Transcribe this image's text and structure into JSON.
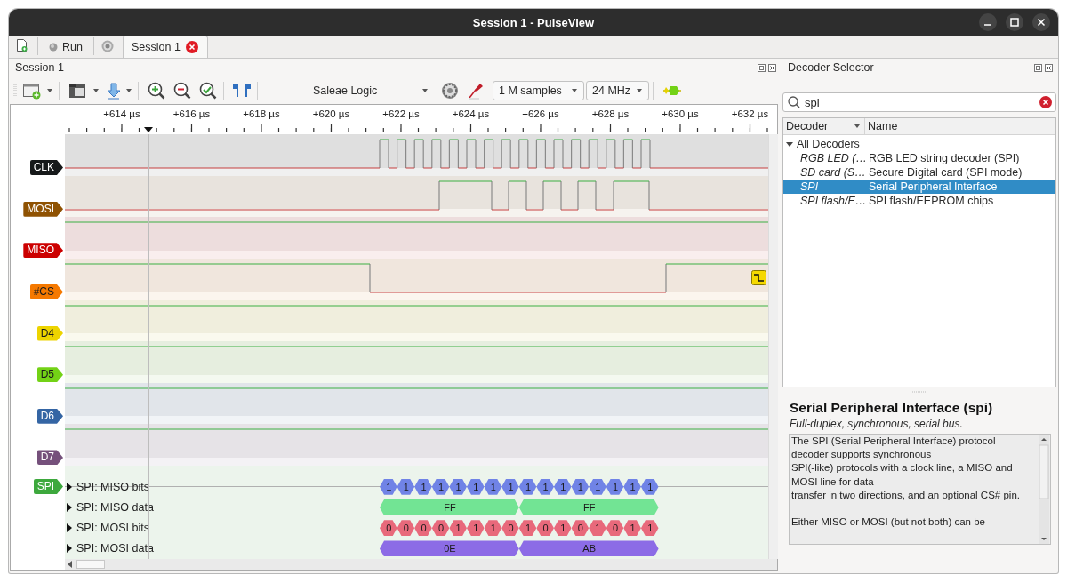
{
  "window": {
    "title": "Session 1 - PulseView"
  },
  "tab_bar": {
    "run_button": {
      "label": "Run"
    },
    "tabs": [
      {
        "label": "Session 1",
        "selected": true
      }
    ]
  },
  "session_panel": {
    "title": "Session 1",
    "toolbar": {
      "device": "Saleae Logic",
      "sample_count": "1 M samples",
      "sample_rate": "24 MHz"
    },
    "ruler": {
      "ticks": [
        "+614 µs",
        "+616 µs",
        "+618 µs",
        "+620 µs",
        "+622 µs",
        "+624 µs",
        "+626 µs",
        "+628 µs",
        "+630 µs",
        "+632 µs"
      ]
    },
    "channels": [
      {
        "name": "CLK",
        "color": "#16191a"
      },
      {
        "name": "MOSI",
        "color": "#8f5202"
      },
      {
        "name": "MISO",
        "color": "#cc0000"
      },
      {
        "name": "#CS",
        "color": "#f57900",
        "falling_edge_trigger": true
      },
      {
        "name": "D4",
        "color": "#edd400"
      },
      {
        "name": "D5",
        "color": "#73d216"
      },
      {
        "name": "D6",
        "color": "#3465a4"
      },
      {
        "name": "D7",
        "color": "#75507b"
      }
    ],
    "decoder": {
      "name": "SPI",
      "color": "#3da83d",
      "rows": [
        {
          "label": "SPI: MISO bits",
          "kind": "bits",
          "color": "#7083e6",
          "expanded": false,
          "annotations": [
            "1",
            "1",
            "1",
            "1",
            "1",
            "1",
            "1",
            "1",
            "1",
            "1",
            "1",
            "1",
            "1",
            "1",
            "1",
            "1"
          ]
        },
        {
          "label": "SPI: MISO data",
          "kind": "bytes",
          "color": "#72e494",
          "expanded": false,
          "annotations": [
            "FF",
            "FF"
          ]
        },
        {
          "label": "SPI: MOSI bits",
          "kind": "bits",
          "color": "#e8697b",
          "expanded": false,
          "annotations": [
            "0",
            "0",
            "0",
            "0",
            "1",
            "1",
            "1",
            "0",
            "1",
            "0",
            "1",
            "0",
            "1",
            "0",
            "1",
            "1"
          ]
        },
        {
          "label": "SPI: MOSI data",
          "kind": "bytes",
          "color": "#8c6ce6",
          "expanded": false,
          "annotations": [
            "0E",
            "AB"
          ]
        }
      ]
    }
  },
  "decoder_selector": {
    "title": "Decoder Selector",
    "search": {
      "value": "spi"
    },
    "columns": [
      "Decoder",
      "Name"
    ],
    "tree": [
      {
        "label": "All Decoders",
        "expanded": true,
        "children": [
          {
            "decoder": "RGB LED (…",
            "name": "RGB LED string decoder (SPI)",
            "selected": false
          },
          {
            "decoder": "SD card (S…",
            "name": "Secure Digital card (SPI mode)",
            "selected": false
          },
          {
            "decoder": "SPI",
            "name": "Serial Peripheral Interface",
            "selected": true
          },
          {
            "decoder": "SPI flash/E…",
            "name": "SPI flash/EEPROM chips",
            "selected": false
          }
        ]
      }
    ],
    "info": {
      "title": "Serial Peripheral Interface (spi)",
      "subtitle": "Full-duplex, synchronous, serial bus.",
      "description": "The SPI (Serial Peripheral Interface) protocol decoder supports synchronous\nSPI(-like) protocols with a clock line, a MISO and MOSI line for data\ntransfer in two directions, and an optional CS# pin.\n\nEither MISO or MOSI (but not both) can be"
    }
  }
}
